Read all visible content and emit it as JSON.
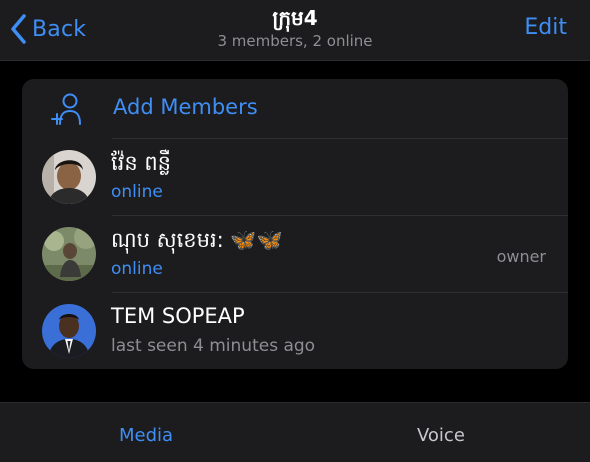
{
  "header": {
    "back_label": "Back",
    "title": "ក្រុម4",
    "subtitle": "3 members, 2 online",
    "edit_label": "Edit"
  },
  "members_card": {
    "add_members_label": "Add Members",
    "members": [
      {
        "name": "វ៉ែន ពន្លឺ",
        "status": "online",
        "role": ""
      },
      {
        "name": "ណុប សុខេមរ: 🦋🦋",
        "status": "online",
        "role": "owner"
      },
      {
        "name": "TEM SOPEAP",
        "status": "last seen 4 minutes ago",
        "role": ""
      }
    ]
  },
  "tabs": [
    {
      "label": "Media",
      "active": true
    },
    {
      "label": "Voice",
      "active": false
    }
  ],
  "colors": {
    "accent": "#3f8ef5",
    "background": "#000000",
    "surface": "#1c1c1e",
    "secondary_text": "#8e8e93"
  },
  "icons": {
    "back": "chevron-left-icon",
    "add_members": "add-person-icon"
  }
}
